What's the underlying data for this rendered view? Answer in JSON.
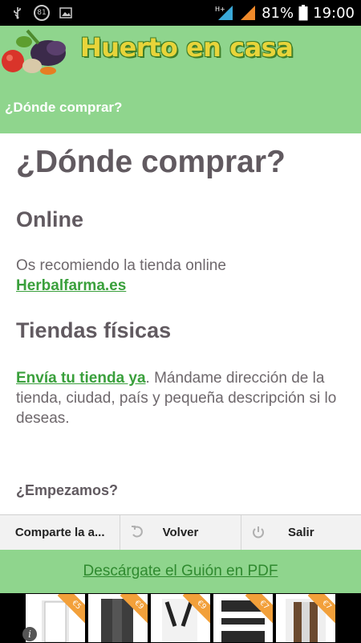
{
  "status_bar": {
    "notification_badge": "81",
    "network_type": "H+",
    "battery": "81%",
    "time": "19:00"
  },
  "header": {
    "logo_text": "Huerto en casa",
    "title": "¿Dónde comprar?"
  },
  "content": {
    "heading": "¿Dónde comprar?",
    "online_heading": "Online",
    "online_text": "Os recomiendo la tienda online",
    "online_link": "Herbalfarma.es",
    "stores_heading": "Tiendas físicas",
    "stores_link": "Envía tu tienda ya",
    "stores_text": ". Mándame dirección de la tienda, ciudad, país y pequeña descripción si lo deseas.",
    "start_text": "¿Empezamos?"
  },
  "bottom_bar": {
    "share_label": "Comparte la a...",
    "back_label": "Volver",
    "exit_label": "Salir"
  },
  "download": {
    "label": "Descárgate el Guión en PDF"
  },
  "ad": {
    "prices": [
      "€5",
      "€9",
      "€9",
      "€7",
      "€7"
    ]
  },
  "colors": {
    "header_green": "#8fd58d",
    "link_green": "#3aa03c",
    "heading_gray": "#615a60"
  }
}
